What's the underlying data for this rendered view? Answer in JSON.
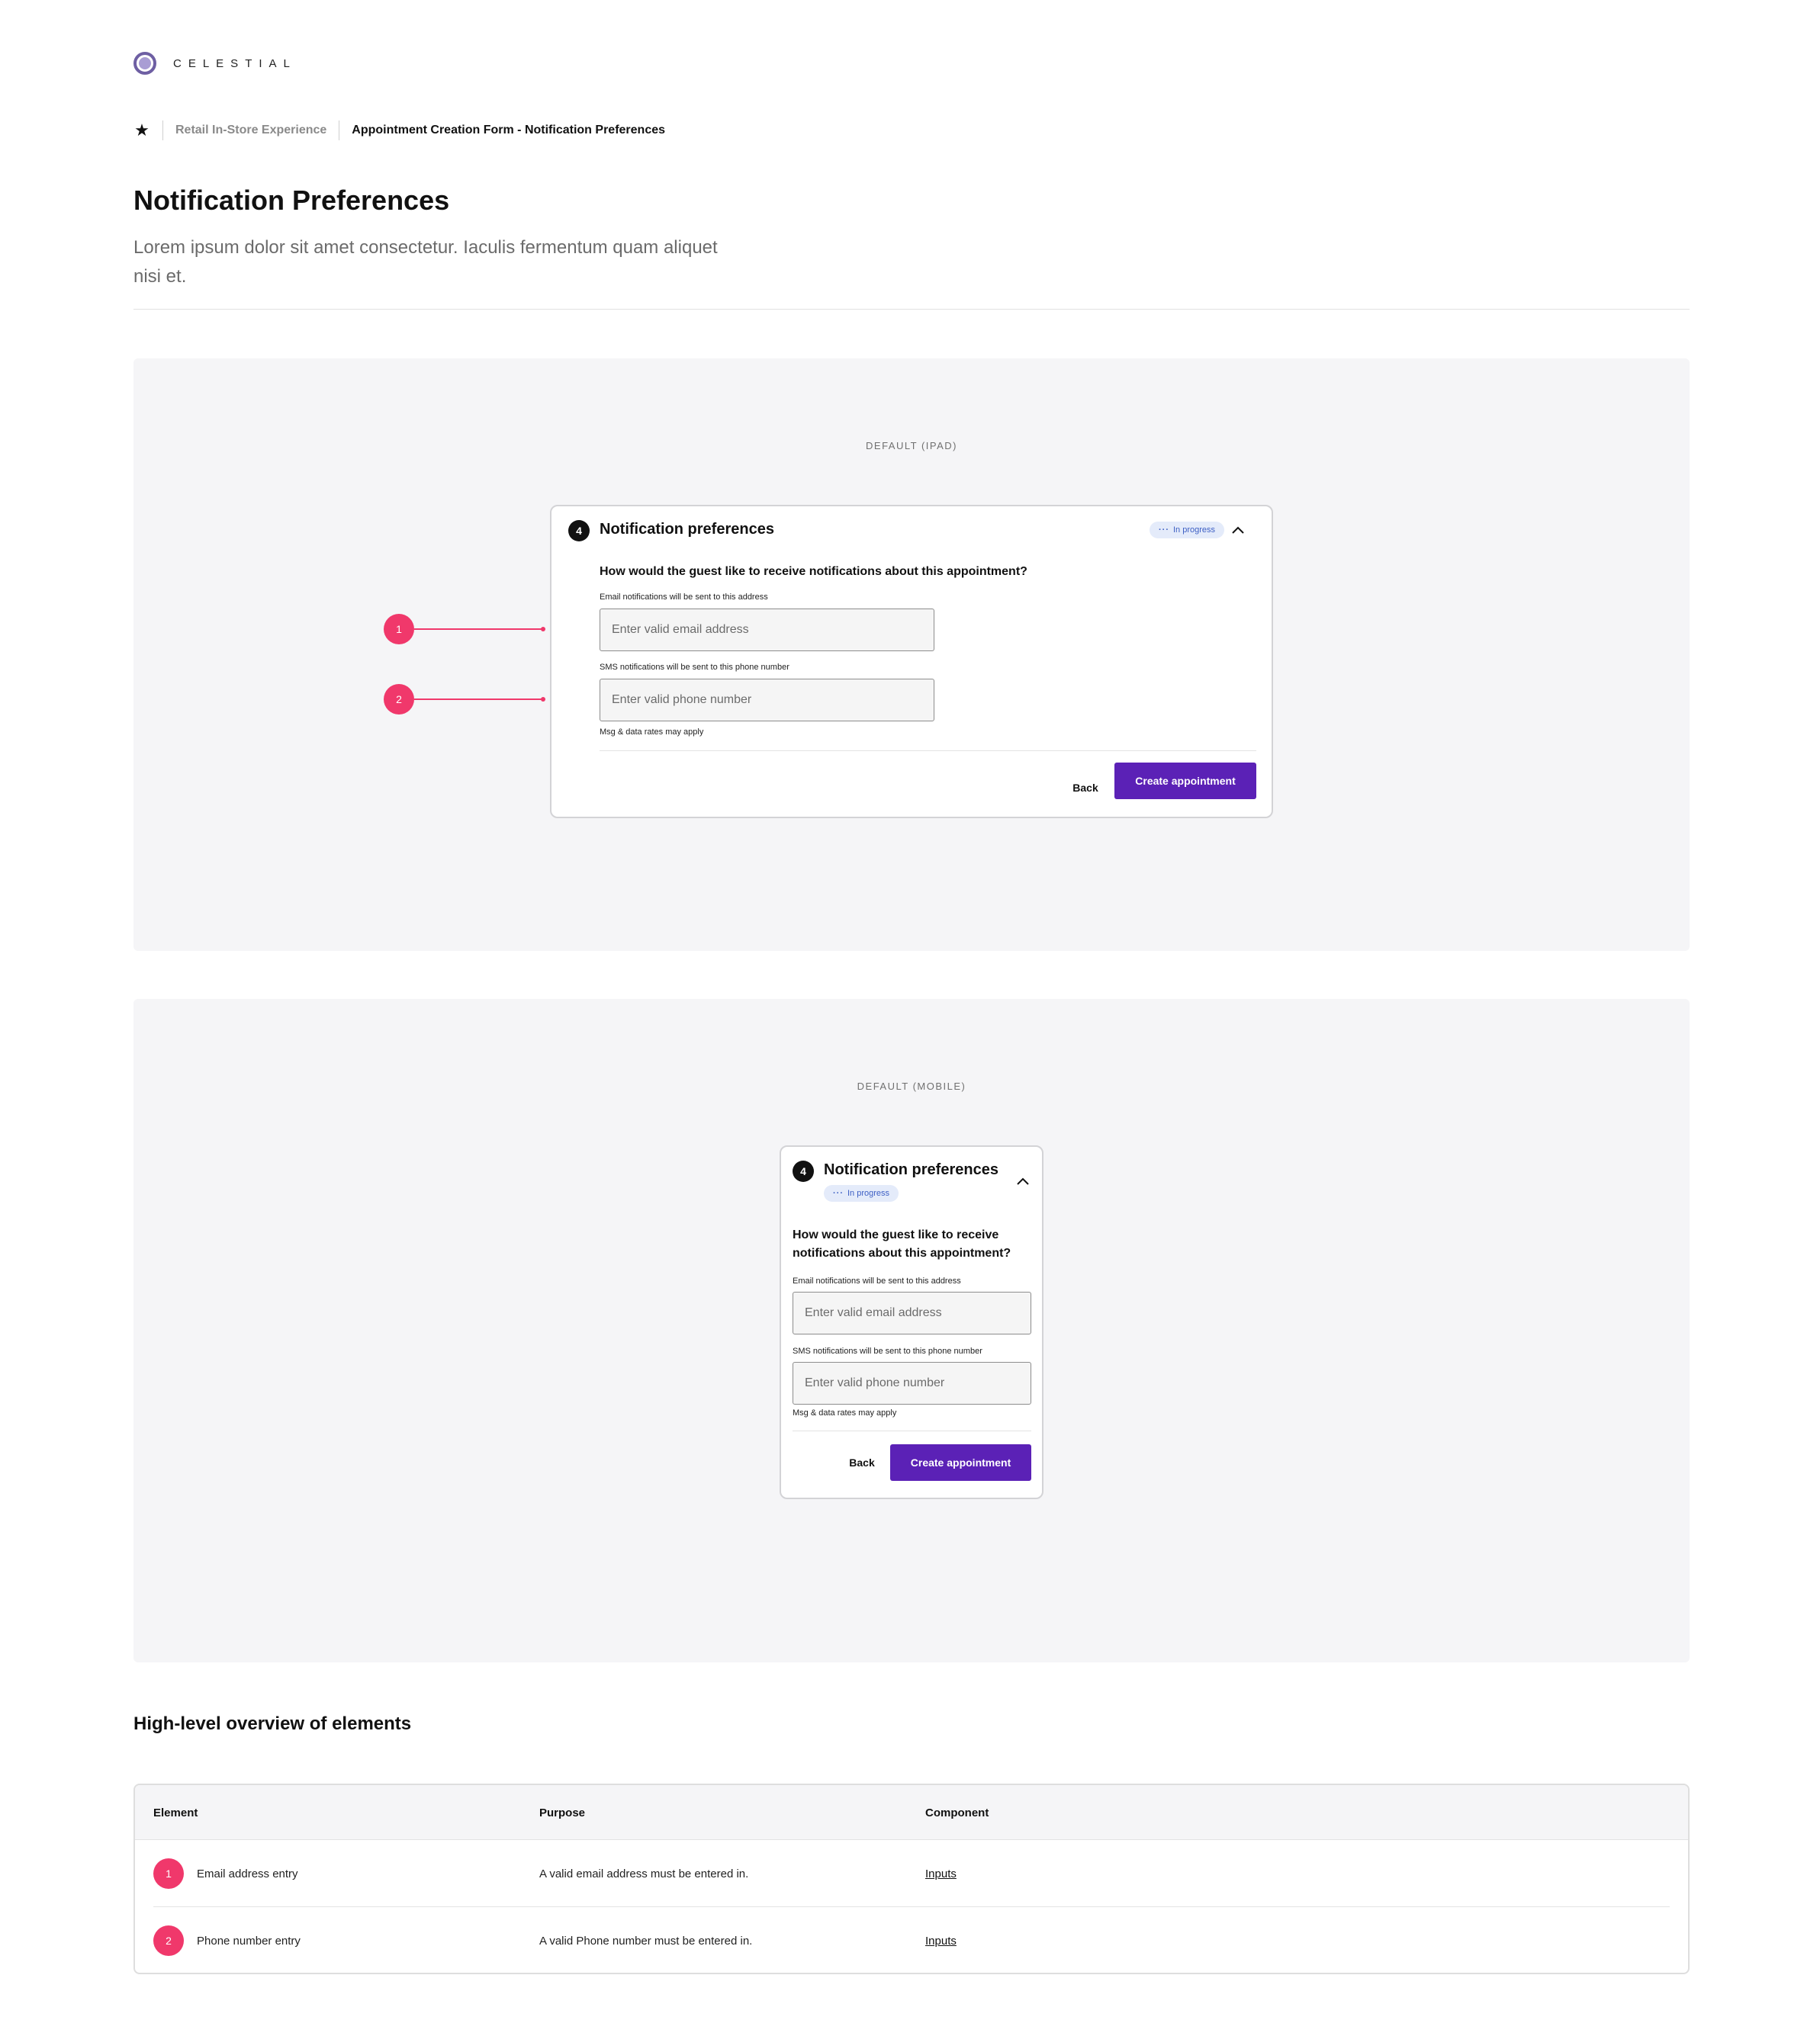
{
  "brand": {
    "name": "CELESTIAL",
    "icon": "celestial-logo-icon"
  },
  "breadcrumb": {
    "icon": "star-icon",
    "parent": "Retail In-Store Experience",
    "current": "Appointment Creation Form - Notification Preferences"
  },
  "page": {
    "title": "Notification Preferences",
    "description": "Lorem ipsum dolor sit amet consectetur. Iaculis fermentum quam aliquet nisi et."
  },
  "ipad": {
    "label": "DEFAULT (IPAD)",
    "card": {
      "step": "4",
      "title": "Notification preferences",
      "status": "In progress",
      "status_icon": "ellipsis-icon",
      "toggle_icon": "chevron-up-icon",
      "question": "How would the guest like to receive notifications about this appointment?",
      "email_label": "Email notifications will be sent to this address",
      "email_placeholder": "Enter valid email address",
      "email_value": "",
      "phone_label": "SMS notifications will be sent to this phone number",
      "phone_placeholder": "Enter valid phone number",
      "phone_value": "",
      "helper": "Msg & data rates may apply",
      "back_label": "Back",
      "primary_label": "Create appointment"
    },
    "markers": [
      "1",
      "2"
    ]
  },
  "mobile": {
    "label": "DEFAULT (MOBILE)",
    "card": {
      "step": "4",
      "title": "Notification preferences",
      "status": "In progress",
      "question": "How would the guest like to receive notifications about this appointment?",
      "email_label": "Email notifications will be sent to this address",
      "email_placeholder": "Enter valid email address",
      "phone_label": "SMS notifications will be sent to this phone number",
      "phone_placeholder": "Enter valid phone number",
      "helper": "Msg & data rates may apply",
      "back_label": "Back",
      "primary_label": "Create appointment"
    }
  },
  "overview": {
    "title": "High-level overview of elements",
    "columns": [
      "Element",
      "Purpose",
      "Component"
    ],
    "rows": [
      {
        "marker": "1",
        "element": "Email address entry",
        "purpose": "A valid email address must be entered in.",
        "component": "Inputs"
      },
      {
        "marker": "2",
        "element": "Phone number entry",
        "purpose": "A valid Phone number must be entered in.",
        "component": "Inputs"
      }
    ]
  },
  "colors": {
    "accent": "#5b21b6",
    "marker": "#f0386b",
    "status_bg": "#e4ebfa",
    "status_text": "#3d5fc4",
    "panel_bg": "#f5f5f7"
  }
}
